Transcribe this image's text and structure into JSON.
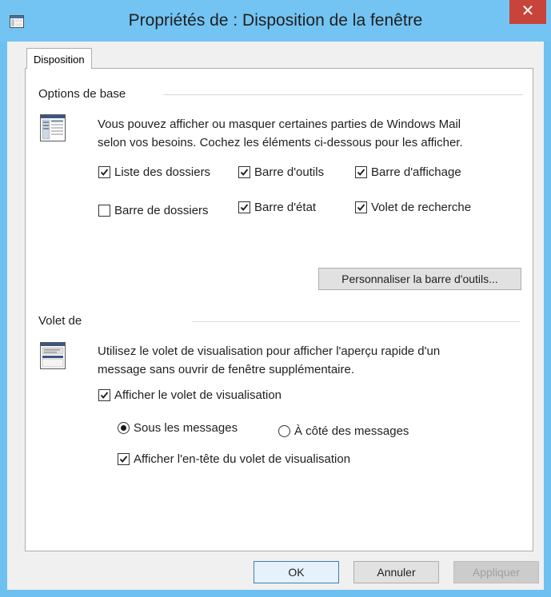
{
  "window": {
    "title": "Propriétés de : Disposition de la fenêtre",
    "close_label": "✕"
  },
  "tabs": [
    {
      "label": "Disposition"
    }
  ],
  "basic": {
    "title": "Options de base",
    "description_line1": "Vous pouvez afficher ou masquer certaines parties de Windows Mail",
    "description_line2": "selon vos besoins. Cochez les éléments ci-dessous pour les afficher.",
    "checkboxes": [
      {
        "label": "Liste des dossiers",
        "checked": true
      },
      {
        "label": "Barre d'outils",
        "checked": true
      },
      {
        "label": "Barre d'affichage",
        "checked": true
      },
      {
        "label": "Barre de dossiers",
        "checked": false
      },
      {
        "label": "Barre d'état",
        "checked": true
      },
      {
        "label": "Volet de recherche",
        "checked": true
      }
    ],
    "customize_button": "Personnaliser la barre d'outils..."
  },
  "preview": {
    "title": "Volet de",
    "description_line1": "Utilisez le volet de visualisation pour afficher l'aperçu rapide d'un",
    "description_line2": "message sans ouvrir de fenêtre supplémentaire.",
    "show_preview": {
      "label": "Afficher le volet de visualisation",
      "checked": true
    },
    "radios": [
      {
        "label": "Sous les messages",
        "selected": true
      },
      {
        "label": "À côté des messages",
        "selected": false
      }
    ],
    "show_header": {
      "label": "Afficher l'en-tête du volet de visualisation",
      "checked": true
    }
  },
  "buttons": {
    "ok": "OK",
    "cancel": "Annuler",
    "apply": "Appliquer"
  },
  "colors": {
    "titlebar": "#73c4f2",
    "close": "#c7443a",
    "dialog_bg": "#f0f0f0"
  }
}
